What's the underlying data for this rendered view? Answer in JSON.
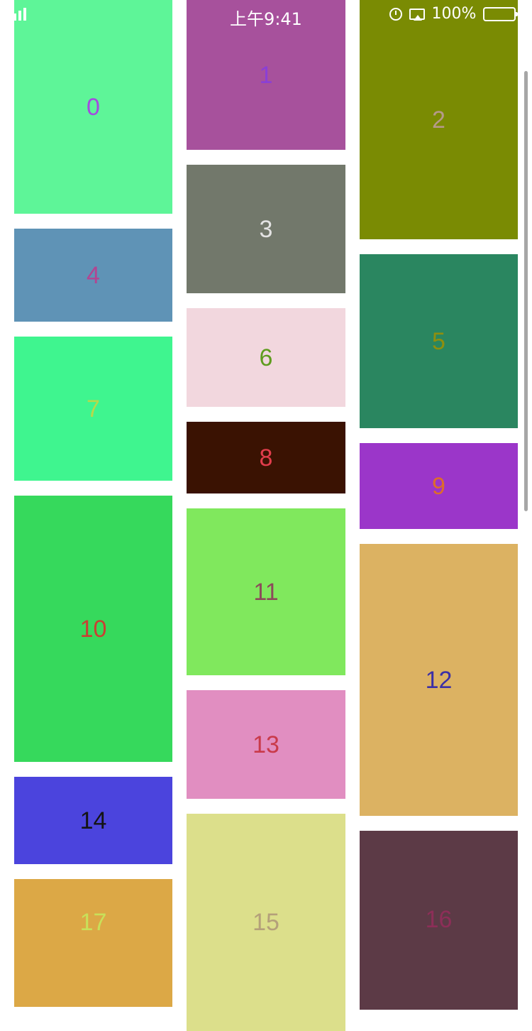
{
  "status_bar": {
    "time": "上午9:41",
    "battery_percent": "100%",
    "battery_level": 1.0,
    "icons": [
      "signal-icon",
      "alarm-icon",
      "airplay-icon",
      "battery-icon",
      "charging-bolt-icon"
    ]
  },
  "cells": [
    {
      "label": "0",
      "bg": "#5ef598",
      "fg": "#a34be0"
    },
    {
      "label": "1",
      "bg": "#a7519c",
      "fg": "#8a3fd6"
    },
    {
      "label": "2",
      "bg": "#7a8b03",
      "fg": "#b59a8a"
    },
    {
      "label": "3",
      "bg": "#72786b",
      "fg": "#e3e3e3"
    },
    {
      "label": "4",
      "bg": "#5f93b6",
      "fg": "#b24592"
    },
    {
      "label": "5",
      "bg": "#2a8660",
      "fg": "#8f8f0e"
    },
    {
      "label": "6",
      "bg": "#f2d7de",
      "fg": "#5f9c1e"
    },
    {
      "label": "7",
      "bg": "#3ff58f",
      "fg": "#b7d94a"
    },
    {
      "label": "8",
      "bg": "#3a1202",
      "fg": "#e23d4c"
    },
    {
      "label": "9",
      "bg": "#9b36c9",
      "fg": "#dd6d2a"
    },
    {
      "label": "10",
      "bg": "#36d95c",
      "fg": "#c93f33"
    },
    {
      "label": "11",
      "bg": "#80e85d",
      "fg": "#8c4b5a"
    },
    {
      "label": "12",
      "bg": "#dcb262",
      "fg": "#3b2fa6"
    },
    {
      "label": "13",
      "bg": "#e18ec1",
      "fg": "#c93a4a"
    },
    {
      "label": "14",
      "bg": "#4b44dd",
      "fg": "#141414"
    },
    {
      "label": "15",
      "bg": "#dcdf8b",
      "fg": "#b4a07a"
    },
    {
      "label": "16",
      "bg": "#5c3a46",
      "fg": "#8d2e58"
    },
    {
      "label": "17",
      "bg": "#dca846",
      "fg": "#c8e05a"
    }
  ]
}
